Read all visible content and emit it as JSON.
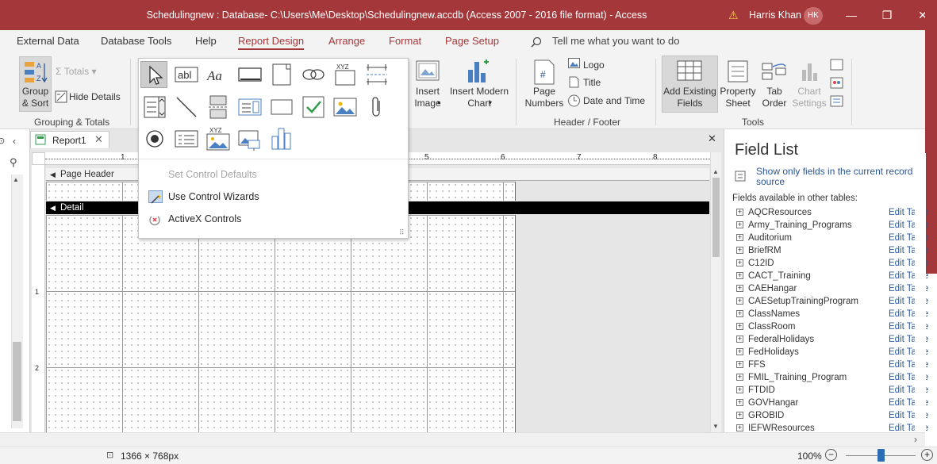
{
  "titlebar": {
    "title": "Schedulingnew : Database- C:\\Users\\Me\\Desktop\\Schedulingnew.accdb (Access 2007 - 2016 file format)  -  Access",
    "user_name": "Harris Khan",
    "user_initials": "HK",
    "minimize": "—",
    "restore": "❐",
    "close": "✕"
  },
  "tabs": [
    "External Data",
    "Database Tools",
    "Help",
    "Report Design",
    "Arrange",
    "Format",
    "Page Setup"
  ],
  "tell_me": "Tell me what you want to do",
  "ribbon": {
    "group_sort": "Group\n& Sort",
    "totals": "Totals",
    "hide_details": "Hide Details",
    "grouping_totals": "Grouping & Totals",
    "insert_image": "Insert\nImage",
    "insert_modern_chart": "Insert Modern\nChart",
    "page_numbers": "Page\nNumbers",
    "logo": "Logo",
    "title": "Title",
    "date_time": "Date and Time",
    "header_footer": "Header / Footer",
    "add_existing_fields": "Add Existing\nFields",
    "property_sheet": "Property\nSheet",
    "tab_order": "Tab\nOrder",
    "chart_settings": "Chart\nSettings",
    "tools": "Tools"
  },
  "controls_popup": {
    "text_box_label": "abl",
    "label_glyph": "Aa",
    "xyz": "XYZ",
    "set_control_defaults": "Set Control Defaults",
    "use_control_wizards": "Use Control Wizards",
    "activex_controls": "ActiveX Controls"
  },
  "document": {
    "tab_name": "Report1",
    "page_header": "Page Header",
    "detail": "Detail",
    "ruler_numbers": [
      "1",
      "5",
      "6",
      "7",
      "8"
    ],
    "vruler_numbers": [
      "1",
      "2"
    ]
  },
  "field_list": {
    "title": "Field List",
    "show_only": "Show only fields in the current record source",
    "other_tables": "Fields available in other tables:",
    "edit_label": "Edit Table",
    "tables": [
      "AQCResources",
      "Army_Training_Programs",
      "Auditorium",
      "BriefRM",
      "C12ID",
      "CACT_Training",
      "CAEHangar",
      "CAESetupTrainingProgram",
      "ClassNames",
      "ClassRoom",
      "FederalHolidays",
      "FedHolidays",
      "FFS",
      "FMIL_Training_Program",
      "FTDID",
      "GOVHangar",
      "GROBID",
      "IEFWResources"
    ]
  },
  "statusbar": {
    "dimensions": "1366 × 768px",
    "zoom": "100%",
    "zoom_level": 0.5
  },
  "colors": {
    "accent": "#a4373a",
    "link": "#2b5797"
  }
}
